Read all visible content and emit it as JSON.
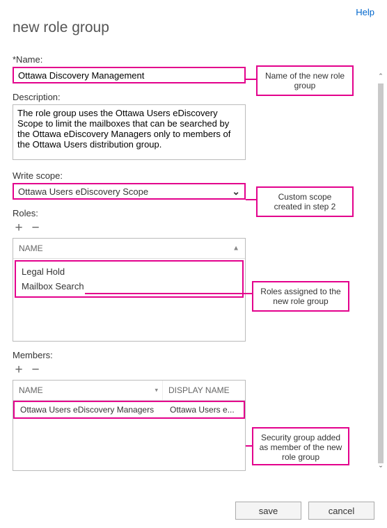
{
  "help_link": "Help",
  "page_title": "new role group",
  "name": {
    "label": "*Name:",
    "value": "Ottawa Discovery Management"
  },
  "description": {
    "label": "Description:",
    "value": "The role group uses the Ottawa Users eDiscovery Scope to limit the mailboxes that can be searched by the Ottawa eDiscovery Managers only to members of the Ottawa Users distribution group."
  },
  "write_scope": {
    "label": "Write scope:",
    "selected": "Ottawa Users eDiscovery Scope"
  },
  "roles": {
    "label": "Roles:",
    "header_name": "NAME",
    "items": [
      "Legal Hold",
      "Mailbox Search"
    ]
  },
  "members": {
    "label": "Members:",
    "header_name": "NAME",
    "header_display": "DISPLAY NAME",
    "rows": [
      {
        "name": "Ottawa Users eDiscovery Managers",
        "display": "Ottawa Users e..."
      }
    ]
  },
  "callouts": {
    "name": "Name of the new role group",
    "scope": "Custom scope created in step 2",
    "roles": "Roles assigned to the new role group",
    "members": "Security group added as member of the new role group"
  },
  "buttons": {
    "save": "save",
    "cancel": "cancel"
  }
}
